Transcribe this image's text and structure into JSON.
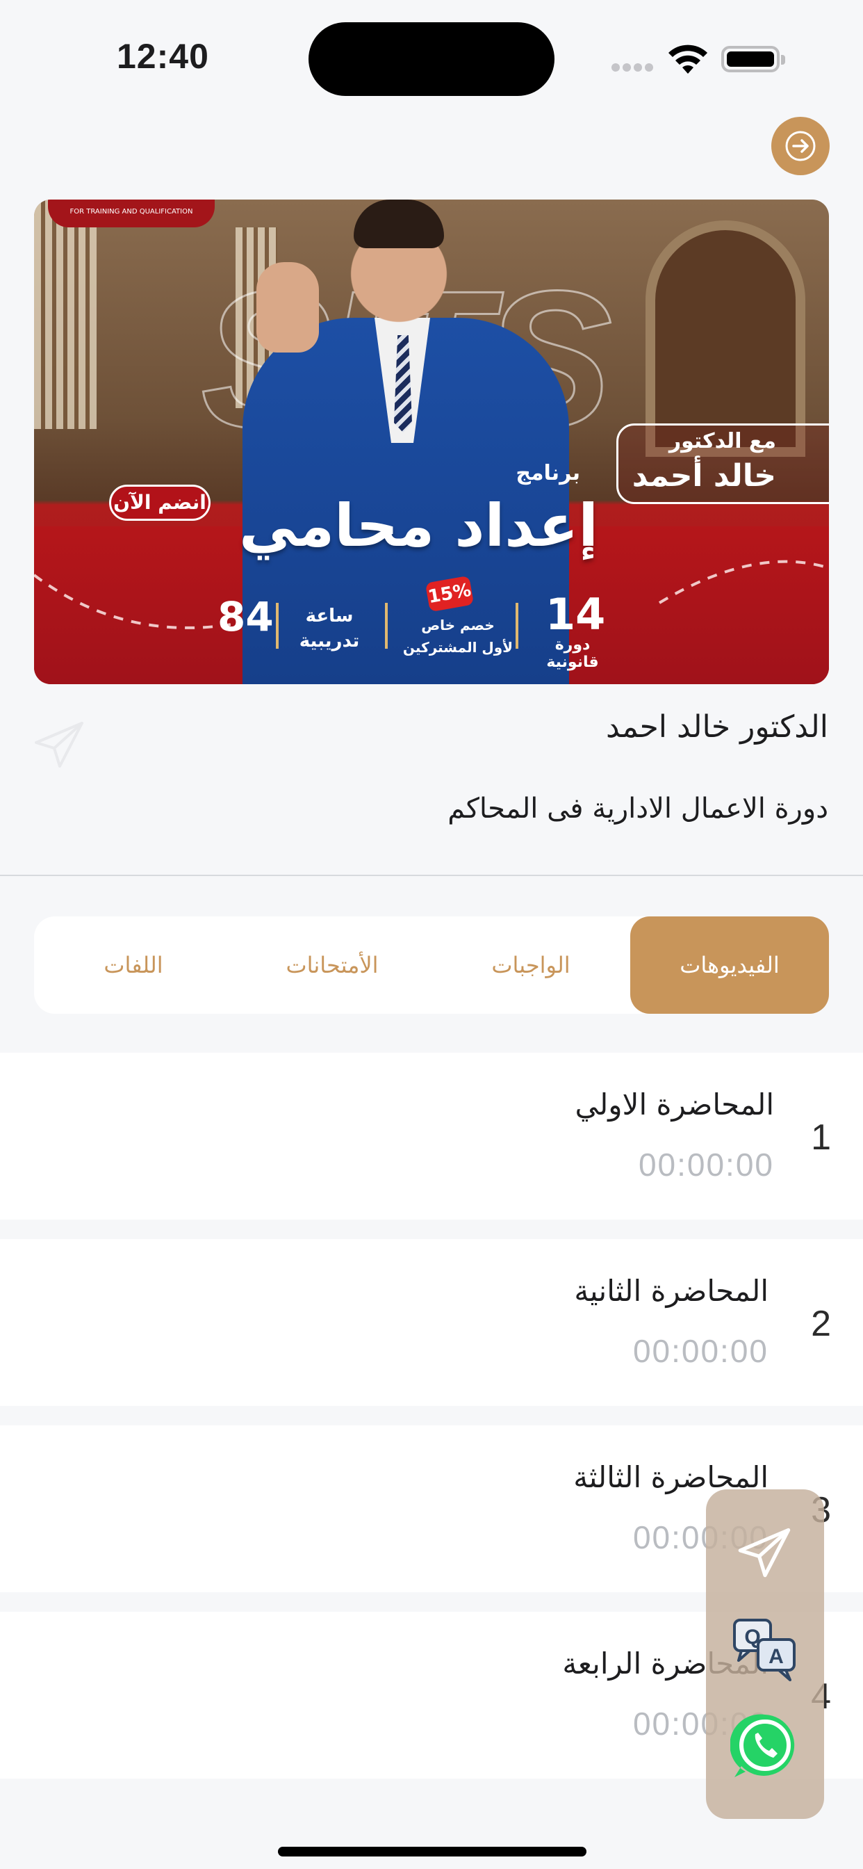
{
  "status_bar": {
    "time": "12:40"
  },
  "banner": {
    "logo_tagline": "FOR TRAINING AND QUALIFICATION",
    "with_doctor": "مع الدكتور",
    "doctor_name": "خالد أحمد",
    "program_label": "برنامج",
    "program_title": "إعداد محامي",
    "join_now": "انضم الآن",
    "stats": [
      {
        "number": "14",
        "label": "دورة قانونية"
      },
      {
        "badge": "15%",
        "label_line1": "خصم خاص",
        "label_line2": "لأول المشتركين"
      },
      {
        "number": "84",
        "label_line1": "ساعة",
        "label_line2": "تدريبية"
      }
    ]
  },
  "course": {
    "doctor": "الدكتور خالد احمد",
    "title": "دورة الاعمال الادارية فى المحاكم"
  },
  "tabs": [
    {
      "label": "الفيديوهات",
      "active": true
    },
    {
      "label": "الواجبات",
      "active": false
    },
    {
      "label": "الأمتحانات",
      "active": false
    },
    {
      "label": "اللفات",
      "active": false
    }
  ],
  "lectures": [
    {
      "num": "1",
      "title": "المحاضرة الاولي",
      "time": "00:00:00"
    },
    {
      "num": "2",
      "title": "المحاضرة الثانية",
      "time": "00:00:00"
    },
    {
      "num": "3",
      "title": "المحاضرة الثالثة",
      "time": "00:00:00"
    },
    {
      "num": "4",
      "title": "المحاضرة الرابعة",
      "time": "00:00:00"
    }
  ],
  "fab": {
    "items": [
      "send-icon",
      "qa-icon",
      "whatsapp-icon"
    ]
  },
  "colors": {
    "accent": "#c8955a",
    "banner_red": "#b01d1d",
    "whatsapp": "#25d366"
  }
}
